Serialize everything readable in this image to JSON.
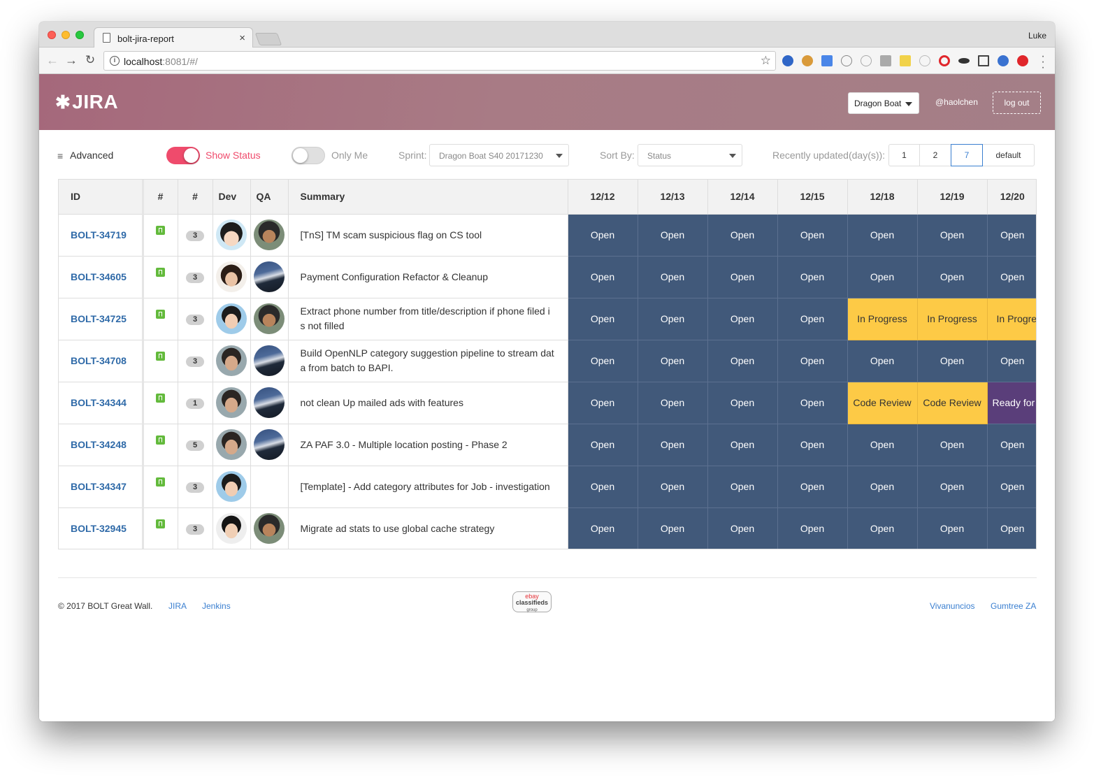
{
  "browser": {
    "tab_title": "bolt-jira-report",
    "tab_close": "×",
    "profile_name": "Luke",
    "url_host": "localhost",
    "url_rest": ":8081/#/"
  },
  "header": {
    "logo_text": "JIRA",
    "team_select": "Dragon Boat",
    "user_handle": "@haolchen",
    "logout_label": "log out"
  },
  "controls": {
    "advanced_label": "Advanced",
    "show_status_label": "Show Status",
    "show_status_on": true,
    "only_me_label": "Only Me",
    "only_me_on": false,
    "sprint_label": "Sprint:",
    "sprint_value": "Dragon Boat S40 20171230",
    "sort_label": "Sort By:",
    "sort_value": "Status",
    "recent_label": "Recently updated(day(s)):",
    "recent_options": [
      "1",
      "2",
      "7",
      "default"
    ],
    "recent_selected": "7"
  },
  "table": {
    "headers": {
      "id": "ID",
      "type": "#",
      "points": "#",
      "dev": "Dev",
      "qa": "QA",
      "summary": "Summary",
      "dates": [
        "12/12",
        "12/13",
        "12/14",
        "12/15",
        "12/18",
        "12/19",
        "12/20"
      ]
    },
    "rows": [
      {
        "id": "BOLT-34719",
        "points": "3",
        "dev": "girl-avatar",
        "qa": "bot-avatar",
        "summary": "[TnS] TM scam suspicious flag on CS tool",
        "statuses": [
          "Open",
          "Open",
          "Open",
          "Open",
          "Open",
          "Open",
          "Open"
        ]
      },
      {
        "id": "BOLT-34605",
        "points": "3",
        "dev": "woman-avatar",
        "qa": "mountain-avatar",
        "summary": "Payment Configuration Refactor & Cleanup",
        "statuses": [
          "Open",
          "Open",
          "Open",
          "Open",
          "Open",
          "Open",
          "Open"
        ]
      },
      {
        "id": "BOLT-34725",
        "points": "3",
        "dev": "boy-avatar",
        "qa": "bot-avatar",
        "summary": "Extract phone number from title/description if phone filed is not filled",
        "statuses": [
          "Open",
          "Open",
          "Open",
          "Open",
          "In Progress",
          "In Progress",
          "In Progre"
        ]
      },
      {
        "id": "BOLT-34708",
        "points": "3",
        "dev": "man-avatar",
        "qa": "mountain-avatar",
        "summary": "Build OpenNLP category suggestion pipeline to stream data from batch to BAPI.",
        "statuses": [
          "Open",
          "Open",
          "Open",
          "Open",
          "Open",
          "Open",
          "Open"
        ]
      },
      {
        "id": "BOLT-34344",
        "points": "1",
        "dev": "man-avatar",
        "qa": "mountain-avatar",
        "summary": "not clean Up mailed ads with features",
        "statuses": [
          "Open",
          "Open",
          "Open",
          "Open",
          "Code Review",
          "Code Review",
          "Ready for"
        ]
      },
      {
        "id": "BOLT-34248",
        "points": "5",
        "dev": "man-avatar",
        "qa": "mountain-avatar",
        "summary": "ZA PAF 3.0 - Multiple location posting - Phase 2",
        "statuses": [
          "Open",
          "Open",
          "Open",
          "Open",
          "Open",
          "Open",
          "Open"
        ]
      },
      {
        "id": "BOLT-34347",
        "points": "3",
        "dev": "boy-avatar",
        "qa": "",
        "summary": "[Template] - Add category attributes for Job - investigation",
        "statuses": [
          "Open",
          "Open",
          "Open",
          "Open",
          "Open",
          "Open",
          "Open"
        ]
      },
      {
        "id": "BOLT-32945",
        "points": "3",
        "dev": "boy2-avatar",
        "qa": "bot-avatar",
        "summary": "Migrate ad stats to use global cache strategy",
        "statuses": [
          "Open",
          "Open",
          "Open",
          "Open",
          "Open",
          "Open",
          "Open"
        ]
      }
    ]
  },
  "status_colors": {
    "Open": "#41597a",
    "In Progress": "#fdca46",
    "Code Review": "#fdca46",
    "Ready for": "#5a3e7a"
  },
  "footer": {
    "copyright": "© 2017 BOLT Great Wall.",
    "links_left": [
      "JIRA",
      "Jenkins"
    ],
    "logo_lines": [
      "ebay",
      "classifieds",
      "group"
    ],
    "links_right": [
      "Vivanuncios",
      "Gumtree ZA"
    ]
  }
}
